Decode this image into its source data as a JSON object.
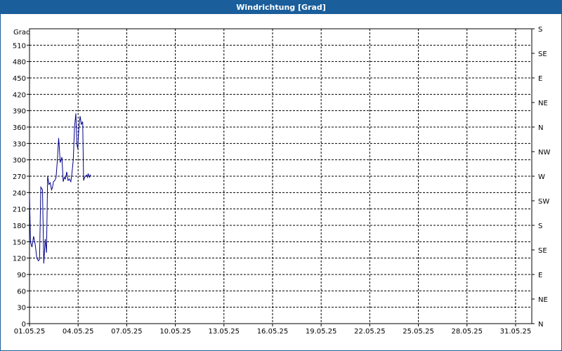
{
  "window": {
    "title": "Windrichtung [Grad]"
  },
  "chart_data": {
    "type": "line",
    "title": "Windrichtung [Grad]",
    "ylabel": "Grad",
    "ylim": [
      0,
      540
    ],
    "yticks": [
      0,
      30,
      60,
      90,
      120,
      150,
      180,
      210,
      240,
      270,
      300,
      330,
      360,
      390,
      420,
      450,
      480,
      510
    ],
    "right_axis_labels": [
      "N",
      "NE",
      "E",
      "SE",
      "S",
      "SW",
      "W",
      "NW",
      "N",
      "NE",
      "E",
      "SE",
      "S"
    ],
    "xlim": [
      "01.05.25",
      "01.06.25"
    ],
    "xticks": [
      "01.05.25",
      "04.05.25",
      "07.05.25",
      "10.05.25",
      "13.05.25",
      "16.05.25",
      "19.05.25",
      "22.05.25",
      "25.05.25",
      "28.05.25",
      "31.05.25"
    ],
    "grid": true,
    "series_color": "#00008b",
    "series": [
      {
        "x": [
          1.0,
          1.06,
          1.15,
          1.25,
          1.35,
          1.45,
          1.55,
          1.62,
          1.7,
          1.8,
          1.88,
          1.97,
          2.05,
          2.12,
          2.2,
          2.28,
          2.36,
          2.42,
          2.48,
          2.56,
          2.64,
          2.72,
          2.8,
          2.9,
          3.0,
          3.08,
          3.15,
          3.22,
          3.3,
          3.38,
          3.46,
          3.55,
          3.62,
          3.7,
          3.78,
          3.86,
          3.92,
          3.98,
          4.05,
          4.12,
          4.2,
          4.28,
          4.34,
          4.4,
          4.46,
          4.52,
          4.58,
          4.62,
          4.66,
          4.7,
          4.74,
          4.78
        ],
        "y": [
          235,
          150,
          140,
          160,
          145,
          120,
          115,
          118,
          250,
          245,
          110,
          155,
          130,
          270,
          255,
          258,
          245,
          250,
          260,
          262,
          268,
          300,
          340,
          295,
          305,
          260,
          268,
          265,
          278,
          262,
          265,
          260,
          275,
          300,
          360,
          385,
          330,
          320,
          360,
          380,
          365,
          370,
          262,
          268,
          270,
          272,
          268,
          275,
          270,
          268,
          272,
          270
        ]
      }
    ]
  }
}
